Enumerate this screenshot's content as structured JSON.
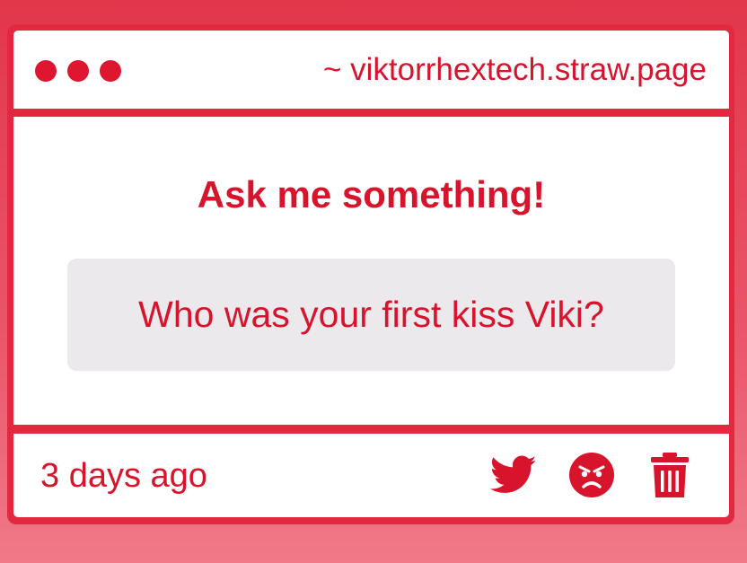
{
  "window": {
    "url": "~ viktorrhextech.straw.page",
    "control_dots": [
      "dot-1",
      "dot-2",
      "dot-3"
    ]
  },
  "content": {
    "title": "Ask me something!",
    "question": "Who was your first kiss Viki?"
  },
  "footer": {
    "timestamp": "3 days ago",
    "actions": [
      {
        "name": "twitter-share",
        "icon": "twitter-icon"
      },
      {
        "name": "angry-react",
        "icon": "angry-face-icon"
      },
      {
        "name": "delete",
        "icon": "trash-icon"
      }
    ]
  },
  "colors": {
    "accent": "#d8142d",
    "frame": "#e2293f",
    "question_bg": "#ece9ec",
    "panel_bg": "#ffffff"
  }
}
